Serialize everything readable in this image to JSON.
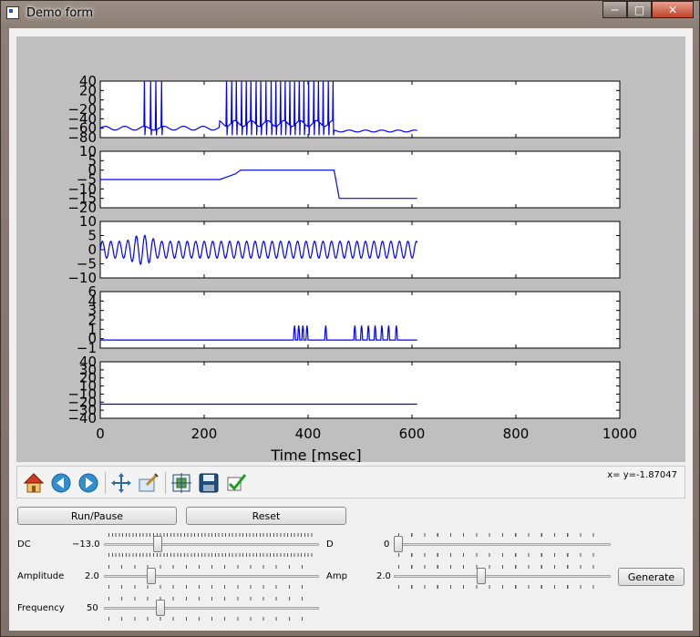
{
  "window": {
    "title": "Demo form"
  },
  "colors": {
    "plot_bg": "#bfbfbf",
    "line": "#0000ff"
  },
  "chart_data": [
    {
      "type": "line",
      "series": [
        {
          "values_description": "spiking membrane trace"
        }
      ],
      "ylim": [
        -80,
        40
      ],
      "yticks": [
        "40",
        "20",
        "0",
        "−20",
        "−40",
        "−60",
        "−80"
      ],
      "xlim": [
        0,
        1000
      ]
    },
    {
      "type": "line",
      "x": [
        0,
        230,
        240,
        250,
        260,
        270,
        450,
        460,
        610
      ],
      "y": [
        -5,
        -5,
        -4,
        -3,
        -2,
        0,
        0,
        -15,
        -15
      ],
      "ylim": [
        -20,
        10
      ],
      "yticks": [
        "10",
        "5",
        "0",
        "−5",
        "−10",
        "−15",
        "−20"
      ],
      "xlim": [
        0,
        1000
      ]
    },
    {
      "type": "line",
      "series": [
        {
          "values_description": "oscillating input"
        }
      ],
      "ylim": [
        -10,
        10
      ],
      "yticks": [
        "10",
        "5",
        "0",
        "−5",
        "−10"
      ],
      "xlim": [
        0,
        1000
      ]
    },
    {
      "type": "line",
      "series": [
        {
          "values_description": "sparse pulses"
        }
      ],
      "ylim": [
        -1,
        6
      ],
      "yticks": [
        "6",
        "4",
        "3",
        "2",
        "1",
        "0",
        "−1"
      ],
      "xlim": [
        0,
        1000
      ]
    },
    {
      "type": "line",
      "x": [
        0,
        610
      ],
      "y": [
        -20,
        -20
      ],
      "ylim": [
        -40,
        40
      ],
      "yticks": [
        "40",
        "30",
        "20",
        "10",
        "−10",
        "−20",
        "−30",
        "−40"
      ],
      "xlim": [
        0,
        1000
      ],
      "xticks": [
        "0",
        "200",
        "400",
        "600",
        "800",
        "1000"
      ],
      "xlabel": "Time [msec]"
    }
  ],
  "toolbar": {
    "icons": [
      "home-icon",
      "back-icon",
      "forward-icon",
      "pan-icon",
      "zoom-icon",
      "subplots-icon",
      "save-icon",
      "check-icon"
    ],
    "coords": "x= y=-1.87047"
  },
  "controls": {
    "run_pause": "Run/Pause",
    "reset": "Reset",
    "dc": {
      "label": "DC",
      "value": "−13.0",
      "fraction": 0.24
    },
    "amplitude": {
      "label": "Amplitude",
      "value": "2.0",
      "fraction": 0.21
    },
    "frequency": {
      "label": "Frequency",
      "value": "50",
      "fraction": 0.25
    },
    "d": {
      "label": "D",
      "value": "0",
      "fraction": 0.0
    },
    "amp": {
      "label": "Amp",
      "value": "2.0",
      "fraction": 0.4
    },
    "generate": "Generate"
  }
}
